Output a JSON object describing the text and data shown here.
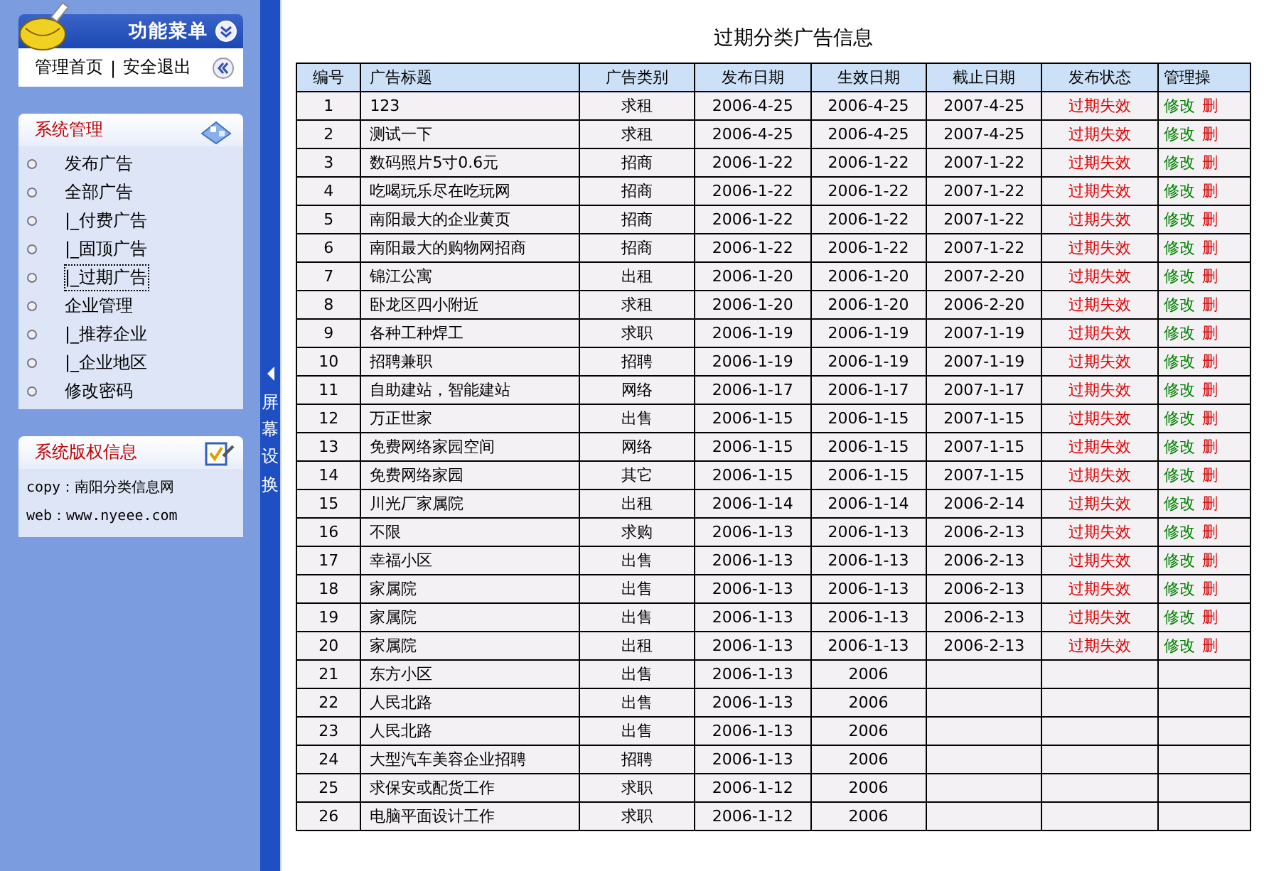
{
  "sidebar": {
    "menu_title": "功能菜单",
    "quick_links": [
      "管理首页",
      "安全退出"
    ],
    "link_separator": "|",
    "panels": [
      {
        "title": "系统管理",
        "kind": "menu",
        "items": [
          {
            "label": "发布广告",
            "selected": false
          },
          {
            "label": "全部广告",
            "selected": false
          },
          {
            "label": "|_付费广告",
            "selected": false
          },
          {
            "label": "|_固顶广告",
            "selected": false
          },
          {
            "label": "|_过期广告",
            "selected": true
          },
          {
            "label": "企业管理",
            "selected": false
          },
          {
            "label": "|_推荐企业",
            "selected": false
          },
          {
            "label": "|_企业地区",
            "selected": false
          },
          {
            "label": "修改密码",
            "selected": false
          }
        ]
      },
      {
        "title": "系统版权信息",
        "kind": "info",
        "lines": [
          "copy：南阳分类信息网",
          "web：www.nyeee.com"
        ]
      }
    ]
  },
  "splitter": {
    "label": "屏幕设换"
  },
  "table": {
    "title": "过期分类广告信息",
    "columns": [
      "编号",
      "广告标题",
      "广告类别",
      "发布日期",
      "生效日期",
      "截止日期",
      "发布状态",
      "管理操"
    ],
    "rows": [
      {
        "id": "1",
        "title": "123",
        "category": "求租",
        "published": "2006-4-25",
        "effective": "2006-4-25",
        "expires": "2007-4-25",
        "status": "过期失效",
        "edit": "修改",
        "delete": "删"
      },
      {
        "id": "2",
        "title": "测试一下",
        "category": "求租",
        "published": "2006-4-25",
        "effective": "2006-4-25",
        "expires": "2007-4-25",
        "status": "过期失效",
        "edit": "修改",
        "delete": "删"
      },
      {
        "id": "3",
        "title": "数码照片5寸0.6元",
        "category": "招商",
        "published": "2006-1-22",
        "effective": "2006-1-22",
        "expires": "2007-1-22",
        "status": "过期失效",
        "edit": "修改",
        "delete": "删"
      },
      {
        "id": "4",
        "title": "吃喝玩乐尽在吃玩网",
        "category": "招商",
        "published": "2006-1-22",
        "effective": "2006-1-22",
        "expires": "2007-1-22",
        "status": "过期失效",
        "edit": "修改",
        "delete": "删"
      },
      {
        "id": "5",
        "title": "南阳最大的企业黄页",
        "category": "招商",
        "published": "2006-1-22",
        "effective": "2006-1-22",
        "expires": "2007-1-22",
        "status": "过期失效",
        "edit": "修改",
        "delete": "删"
      },
      {
        "id": "6",
        "title": "南阳最大的购物网招商",
        "category": "招商",
        "published": "2006-1-22",
        "effective": "2006-1-22",
        "expires": "2007-1-22",
        "status": "过期失效",
        "edit": "修改",
        "delete": "删"
      },
      {
        "id": "7",
        "title": "锦江公寓",
        "category": "出租",
        "published": "2006-1-20",
        "effective": "2006-1-20",
        "expires": "2007-2-20",
        "status": "过期失效",
        "edit": "修改",
        "delete": "删"
      },
      {
        "id": "8",
        "title": "卧龙区四小附近",
        "category": "求租",
        "published": "2006-1-20",
        "effective": "2006-1-20",
        "expires": "2006-2-20",
        "status": "过期失效",
        "edit": "修改",
        "delete": "删"
      },
      {
        "id": "9",
        "title": "各种工种焊工",
        "category": "求职",
        "published": "2006-1-19",
        "effective": "2006-1-19",
        "expires": "2007-1-19",
        "status": "过期失效",
        "edit": "修改",
        "delete": "删"
      },
      {
        "id": "10",
        "title": "招聘兼职",
        "category": "招聘",
        "published": "2006-1-19",
        "effective": "2006-1-19",
        "expires": "2007-1-19",
        "status": "过期失效",
        "edit": "修改",
        "delete": "删"
      },
      {
        "id": "11",
        "title": "自助建站，智能建站",
        "category": "网络",
        "published": "2006-1-17",
        "effective": "2006-1-17",
        "expires": "2007-1-17",
        "status": "过期失效",
        "edit": "修改",
        "delete": "删"
      },
      {
        "id": "12",
        "title": "万正世家",
        "category": "出售",
        "published": "2006-1-15",
        "effective": "2006-1-15",
        "expires": "2007-1-15",
        "status": "过期失效",
        "edit": "修改",
        "delete": "删"
      },
      {
        "id": "13",
        "title": "免费网络家园空间",
        "category": "网络",
        "published": "2006-1-15",
        "effective": "2006-1-15",
        "expires": "2007-1-15",
        "status": "过期失效",
        "edit": "修改",
        "delete": "删"
      },
      {
        "id": "14",
        "title": "免费网络家园",
        "category": "其它",
        "published": "2006-1-15",
        "effective": "2006-1-15",
        "expires": "2007-1-15",
        "status": "过期失效",
        "edit": "修改",
        "delete": "删"
      },
      {
        "id": "15",
        "title": "川光厂家属院",
        "category": "出租",
        "published": "2006-1-14",
        "effective": "2006-1-14",
        "expires": "2006-2-14",
        "status": "过期失效",
        "edit": "修改",
        "delete": "删"
      },
      {
        "id": "16",
        "title": "不限",
        "category": "求购",
        "published": "2006-1-13",
        "effective": "2006-1-13",
        "expires": "2006-2-13",
        "status": "过期失效",
        "edit": "修改",
        "delete": "删"
      },
      {
        "id": "17",
        "title": "幸福小区",
        "category": "出售",
        "published": "2006-1-13",
        "effective": "2006-1-13",
        "expires": "2006-2-13",
        "status": "过期失效",
        "edit": "修改",
        "delete": "删"
      },
      {
        "id": "18",
        "title": "家属院",
        "category": "出售",
        "published": "2006-1-13",
        "effective": "2006-1-13",
        "expires": "2006-2-13",
        "status": "过期失效",
        "edit": "修改",
        "delete": "删"
      },
      {
        "id": "19",
        "title": "家属院",
        "category": "出售",
        "published": "2006-1-13",
        "effective": "2006-1-13",
        "expires": "2006-2-13",
        "status": "过期失效",
        "edit": "修改",
        "delete": "删"
      },
      {
        "id": "20",
        "title": "家属院",
        "category": "出租",
        "published": "2006-1-13",
        "effective": "2006-1-13",
        "expires": "2006-2-13",
        "status": "过期失效",
        "edit": "修改",
        "delete": "删"
      },
      {
        "id": "21",
        "title": "东方小区",
        "category": "出售",
        "published": "2006-1-13",
        "effective": "2006"
      },
      {
        "id": "22",
        "title": "人民北路",
        "category": "出售",
        "published": "2006-1-13",
        "effective": "2006"
      },
      {
        "id": "23",
        "title": "人民北路",
        "category": "出售",
        "published": "2006-1-13",
        "effective": "2006"
      },
      {
        "id": "24",
        "title": "大型汽车美容企业招聘",
        "category": "招聘",
        "published": "2006-1-13",
        "effective": "2006"
      },
      {
        "id": "25",
        "title": "求保安或配货工作",
        "category": "求职",
        "published": "2006-1-12",
        "effective": "2006"
      },
      {
        "id": "26",
        "title": "电脑平面设计工作",
        "category": "求职",
        "published": "2006-1-12",
        "effective": "2006"
      }
    ]
  }
}
